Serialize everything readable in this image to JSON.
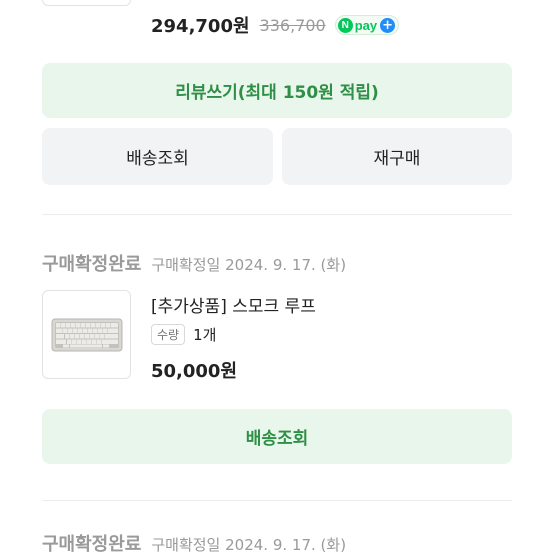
{
  "order_top": {
    "price": "294,700원",
    "original_price": "336,700",
    "npay_badge": {
      "n": "N",
      "text": "pay",
      "plus": "+"
    },
    "review_button": "리뷰쓰기(최대 150원 적립)",
    "shipping_button": "배송조회",
    "reorder_button": "재구매"
  },
  "order_item_2": {
    "status": "구매확정완료",
    "confirm_date": "구매확정일 2024. 9. 17. (화)",
    "product_name": "[추가상품] 스모크 루프",
    "qty_label": "수량",
    "qty_value": "1개",
    "price": "50,000원",
    "shipping_button": "배송조회"
  },
  "order_item_3": {
    "status": "구매확정완료",
    "confirm_date": "구매확정일 2024. 9. 17. (화)"
  },
  "colors": {
    "accent_green": "#2f8f46",
    "green_bg": "#e9f6ec",
    "gray_bg": "#f2f3f5",
    "npay_green": "#03c75a"
  }
}
